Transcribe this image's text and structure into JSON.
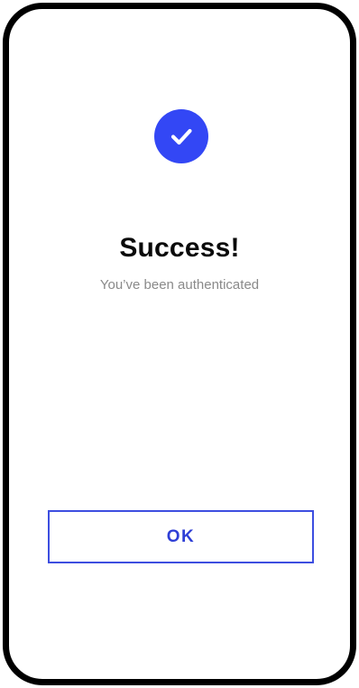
{
  "colors": {
    "accent": "#3347f5",
    "button_border": "#3d4ee0",
    "button_text": "#2f3fd6",
    "title_text": "#0a0a0a",
    "subtitle_text": "#8a8a8a",
    "frame": "#000000"
  },
  "status": {
    "icon": "check-circle-icon",
    "title": "Success!",
    "message": "You’ve been authenticated"
  },
  "actions": {
    "ok_label": "OK"
  }
}
